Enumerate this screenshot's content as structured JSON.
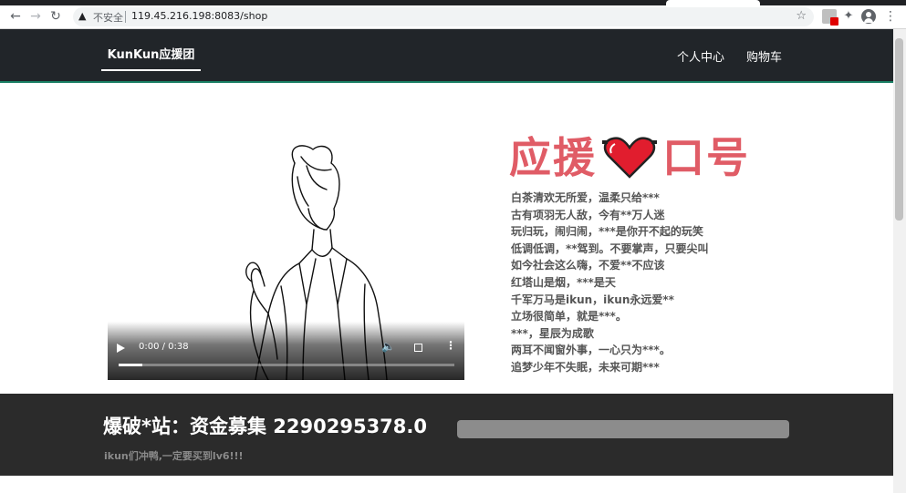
{
  "browser": {
    "security_label": "不安全",
    "url": "119.45.216.198:8083/shop",
    "icons": [
      "back-icon",
      "forward-icon",
      "reload-icon",
      "warning-icon",
      "star-icon",
      "extension-icon",
      "puzzle-icon",
      "profile-icon",
      "menu-icon"
    ]
  },
  "nav": {
    "brand": "KunKun应援团",
    "links": [
      "个人中心",
      "购物车"
    ]
  },
  "video": {
    "time": "0:00 / 0:38",
    "progress": 0.07
  },
  "slogan": {
    "title_left": "应援",
    "title_right": "口号",
    "accent_color": "#e05c66",
    "lines": [
      "白茶清欢无所爱，温柔只给***",
      "古有项羽无人敌，今有**万人迷",
      "玩归玩，闹归闹，***是你开不起的玩笑",
      "低调低调，**驾到。不要掌声，只要尖叫",
      "如今社会这么嗨，不爱**不应该",
      "红塔山是烟，***是天",
      "千军万马是ikun，ikun永远爱**",
      "立场很简单，就是***。",
      "***，星辰为成歌",
      "两耳不闻窗外事，一心只为***。",
      "追梦少年不失眠，未来可期***"
    ]
  },
  "fund": {
    "title": "爆破*站：资金募集 2290295378.0",
    "subtitle": "ikun们冲鸭,一定要买到lv6!!!",
    "progress": 1.0
  }
}
